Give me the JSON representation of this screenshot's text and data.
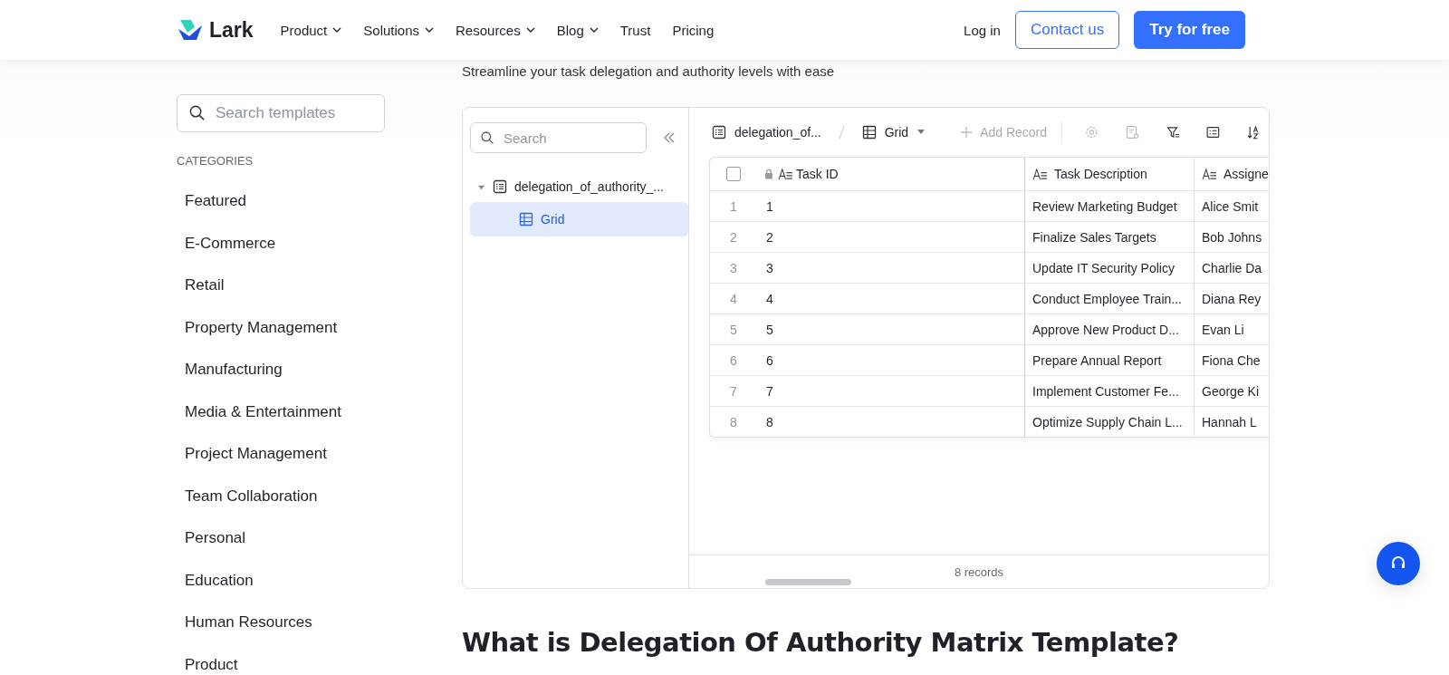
{
  "header": {
    "brand": "Lark",
    "nav": [
      {
        "label": "Product",
        "dropdown": true
      },
      {
        "label": "Solutions",
        "dropdown": true
      },
      {
        "label": "Resources",
        "dropdown": true
      },
      {
        "label": "Blog",
        "dropdown": true
      },
      {
        "label": "Trust",
        "dropdown": false
      },
      {
        "label": "Pricing",
        "dropdown": false
      }
    ],
    "login": "Log in",
    "contact": "Contact us",
    "try": "Try for free"
  },
  "subtitle": "Streamline your task delegation and authority levels with ease",
  "sidebar": {
    "search_placeholder": "Search templates",
    "categories_title": "CATEGORIES",
    "categories": [
      "Featured",
      "E-Commerce",
      "Retail",
      "Property Management",
      "Manufacturing",
      "Media & Entertainment",
      "Project Management",
      "Team Collaboration",
      "Personal",
      "Education",
      "Human Resources",
      "Product"
    ]
  },
  "embed": {
    "search_placeholder": "Search",
    "tree": [
      {
        "label": "delegation_of_authority_...",
        "expanded": true,
        "children": [
          {
            "label": "Grid",
            "selected": true
          }
        ]
      }
    ],
    "toolbar": {
      "table": "delegation_of...",
      "view": "Grid",
      "add_record": "Add Record",
      "add_disabled": true
    },
    "table": {
      "all_selected": false,
      "columns": [
        "Task ID",
        "Task Description",
        "Assigne"
      ],
      "rows": [
        {
          "n": "1",
          "cells": [
            "1",
            "Review Marketing Budget",
            "Alice Smit"
          ]
        },
        {
          "n": "2",
          "cells": [
            "2",
            "Finalize Sales Targets",
            "Bob Johns"
          ]
        },
        {
          "n": "3",
          "cells": [
            "3",
            "Update IT Security Policy",
            "Charlie Da"
          ]
        },
        {
          "n": "4",
          "cells": [
            "4",
            "Conduct Employee Train...",
            "Diana Rey"
          ]
        },
        {
          "n": "5",
          "cells": [
            "5",
            "Approve New Product D...",
            "Evan Li"
          ]
        },
        {
          "n": "6",
          "cells": [
            "6",
            "Prepare Annual Report",
            "Fiona Che"
          ]
        },
        {
          "n": "7",
          "cells": [
            "7",
            "Implement Customer Fe...",
            "George Ki"
          ]
        },
        {
          "n": "8",
          "cells": [
            "8",
            "Optimize Supply Chain L...",
            "Hannah L"
          ]
        }
      ]
    },
    "footer": "8 records"
  },
  "heading": "What is Delegation Of Authority Matrix Template?"
}
